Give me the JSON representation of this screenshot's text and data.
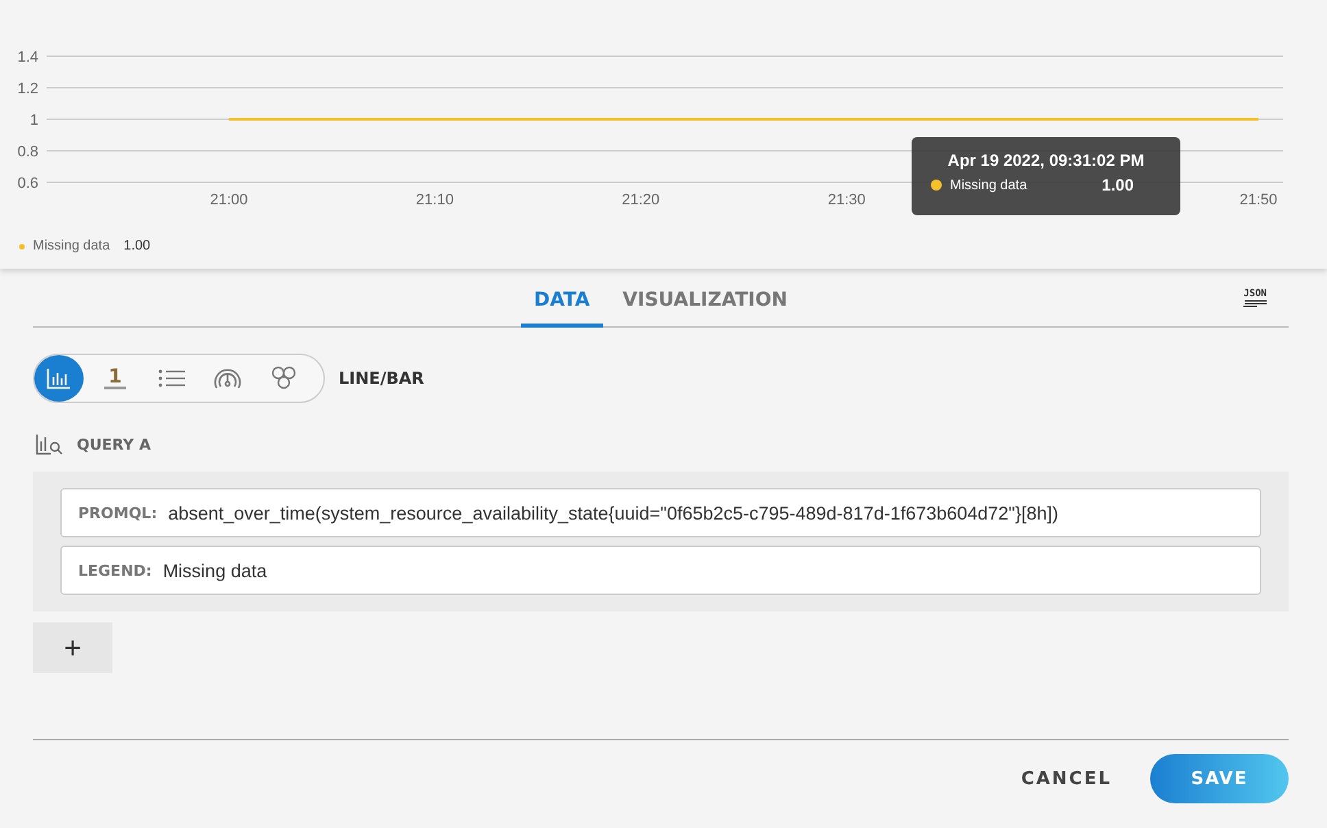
{
  "chart": {
    "chart_data": {
      "type": "line",
      "categories": [
        "21:00",
        "21:10",
        "21:20",
        "21:30",
        null,
        "21:50"
      ],
      "series": [
        {
          "name": "Missing data",
          "color": "#f5c02a",
          "values": [
            1,
            1,
            1,
            1,
            1,
            1
          ]
        }
      ],
      "ylim": [
        0.6,
        1.4
      ],
      "yticks": [
        0.6,
        0.8,
        1,
        1.2,
        1.4
      ],
      "grid": true
    },
    "legend": [
      {
        "value": "1.00"
      }
    ],
    "tooltip": {
      "title": "Apr 19 2022, 09:31:02 PM",
      "series_name": "Missing data",
      "value": "1.00",
      "color": "#f5c02a"
    }
  },
  "tabs": [
    {
      "label": "DATA",
      "selected": true
    },
    {
      "label": "VISUALIZATION",
      "selected": false
    }
  ],
  "json_button": "JSON",
  "visualizations": [
    {
      "kind": "line-bar",
      "selected": true
    },
    {
      "kind": "single-value",
      "label": "1",
      "selected": false
    },
    {
      "kind": "list",
      "selected": false
    },
    {
      "kind": "gauge",
      "selected": false
    },
    {
      "kind": "honeycomb",
      "selected": false
    }
  ],
  "visualization_label": "LINE/BAR",
  "query": {
    "title": "QUERY A",
    "fields": [
      {
        "label": "PROMQL:",
        "value": "absent_over_time(system_resource_availability_state{uuid=\"0f65b2c5-c795-489d-817d-1f673b604d72\"}[8h])"
      },
      {
        "label": "LEGEND:",
        "value": "Missing data"
      }
    ]
  },
  "add_button": "+",
  "buttons": {
    "cancel": "CANCEL",
    "save": "SAVE"
  }
}
